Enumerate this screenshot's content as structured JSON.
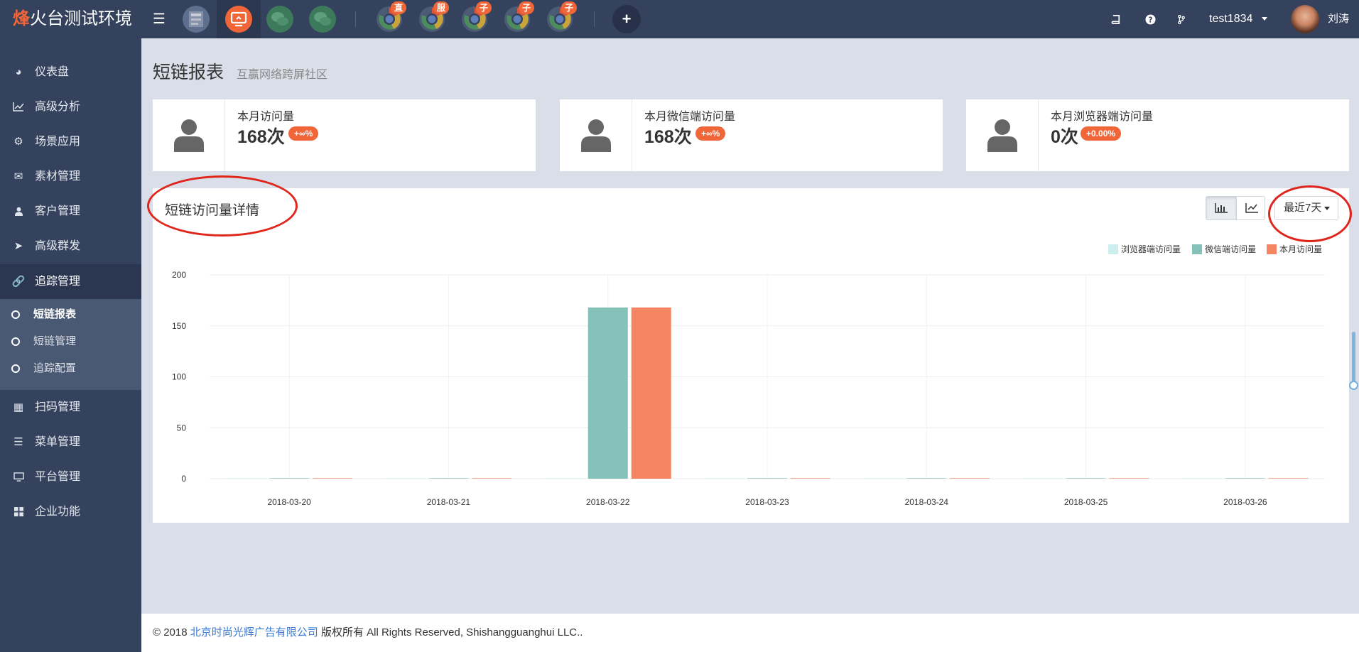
{
  "brand": {
    "accent": "烽",
    "rest": "火台测试环境"
  },
  "topbar": {
    "app_badges": [
      "直",
      "服",
      "子",
      "子",
      "子"
    ],
    "user": "test1834",
    "display_name": "刘涛"
  },
  "sidebar": {
    "items": [
      {
        "label": "仪表盘",
        "icon": "dashboard-icon"
      },
      {
        "label": "高级分析",
        "icon": "line-chart-icon"
      },
      {
        "label": "场景应用",
        "icon": "gear-icon"
      },
      {
        "label": "素材管理",
        "icon": "envelope-icon"
      },
      {
        "label": "客户管理",
        "icon": "user-icon"
      },
      {
        "label": "高级群发",
        "icon": "paper-plane-icon"
      },
      {
        "label": "追踪管理",
        "icon": "link-icon"
      }
    ],
    "sub_items": [
      {
        "label": "短链报表"
      },
      {
        "label": "短链管理"
      },
      {
        "label": "追踪配置"
      }
    ],
    "items_after": [
      {
        "label": "扫码管理",
        "icon": "qrcode-icon"
      },
      {
        "label": "菜单管理",
        "icon": "list-icon"
      },
      {
        "label": "平台管理",
        "icon": "monitor-icon"
      },
      {
        "label": "企业功能",
        "icon": "grid-icon"
      }
    ]
  },
  "page": {
    "title": "短链报表",
    "subtitle": "互赢网络跨屏社区"
  },
  "stats": [
    {
      "label": "本月访问量",
      "value": "168次",
      "change": "+∞%"
    },
    {
      "label": "本月微信端访问量",
      "value": "168次",
      "change": "+∞%"
    },
    {
      "label": "本月浏览器端访问量",
      "value": "0次",
      "change": "+0.00%"
    }
  ],
  "panel": {
    "title": "短链访问量详情",
    "range": "最近7天"
  },
  "chart_data": {
    "type": "bar",
    "categories": [
      "2018-03-20",
      "2018-03-21",
      "2018-03-22",
      "2018-03-23",
      "2018-03-24",
      "2018-03-25",
      "2018-03-26"
    ],
    "series": [
      {
        "name": "浏览器端访问量",
        "color": "#cdeeee",
        "values": [
          0,
          0,
          0,
          0,
          0,
          0,
          0
        ]
      },
      {
        "name": "微信端访问量",
        "color": "#83c1b9",
        "values": [
          0,
          0,
          168,
          0,
          0,
          0,
          0
        ]
      },
      {
        "name": "本月访问量",
        "color": "#f48462",
        "values": [
          0,
          0,
          168,
          0,
          0,
          0,
          0
        ]
      }
    ],
    "ylim": [
      0,
      200
    ],
    "yticks": [
      0,
      50,
      100,
      150,
      200
    ],
    "legend": "top-right",
    "grid": true
  },
  "footer": {
    "prefix": "© 2018 ",
    "company": "北京时尚光辉广告有限公司",
    "suffix": " 版权所有 All Rights Reserved, Shishangguanghui LLC.."
  }
}
